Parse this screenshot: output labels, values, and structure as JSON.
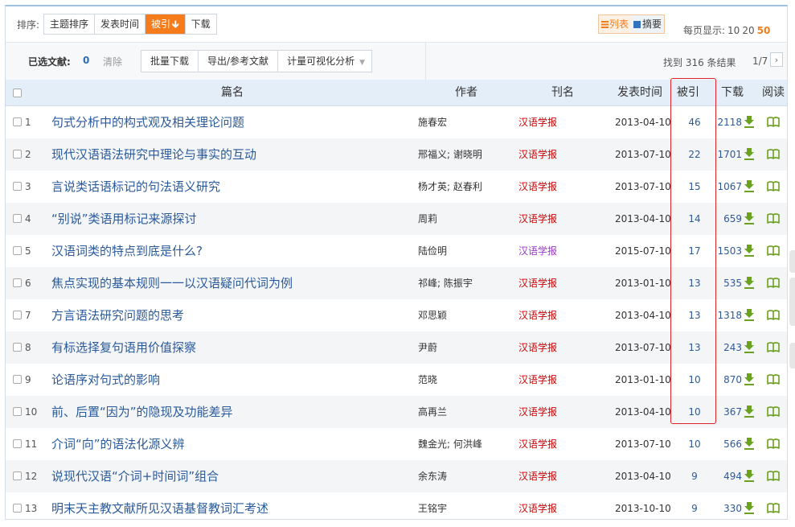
{
  "sort_bar": {
    "label": "排序:",
    "buttons": [
      {
        "label": "主题排序",
        "active": false
      },
      {
        "label": "发表时间",
        "active": false
      },
      {
        "label": "被引",
        "active": true
      },
      {
        "label": "下载",
        "active": false
      }
    ],
    "sort_direction_icon": "arrow-down-icon",
    "view_modes": [
      {
        "label": "列表",
        "icon": "list-icon",
        "active": true
      },
      {
        "label": "摘要",
        "icon": "abstract-icon",
        "active": false
      }
    ],
    "per_page_label": "每页显示:",
    "per_page_options": [
      "10",
      "20",
      "50"
    ],
    "per_page_selected": "50"
  },
  "toolbar": {
    "selected_label": "已选文献:",
    "selected_count": "0",
    "clear_label": "清除",
    "buttons": [
      "批量下载",
      "导出/参考文献",
      "计量可视化分析"
    ],
    "found_text": "找到 316 条结果",
    "page_indicator": "1/7",
    "next_label": "›"
  },
  "table": {
    "columns": [
      "篇名",
      "作者",
      "刊名",
      "发表时间",
      "被引",
      "下载",
      "阅读"
    ],
    "rows": [
      {
        "num": "1",
        "title": "句式分析中的构式观及相关理论问题",
        "author": "施春宏",
        "journal": "汉语学报",
        "date": "2013-04-10",
        "cited": "46",
        "downloads": "2118"
      },
      {
        "num": "2",
        "title": "现代汉语语法研究中理论与事实的互动",
        "author": "邢福义; 谢晓明",
        "journal": "汉语学报",
        "date": "2013-07-10",
        "cited": "22",
        "downloads": "1701"
      },
      {
        "num": "3",
        "title": "言说类话语标记的句法语义研究",
        "author": "杨才英; 赵春利",
        "journal": "汉语学报",
        "date": "2013-07-10",
        "cited": "15",
        "downloads": "1067"
      },
      {
        "num": "4",
        "title": "“别说”类语用标记来源探讨",
        "author": "周莉",
        "journal": "汉语学报",
        "date": "2013-04-10",
        "cited": "14",
        "downloads": "659"
      },
      {
        "num": "5",
        "title": "汉语词类的特点到底是什么?",
        "author": "陆俭明",
        "journal": "汉语学报",
        "date": "2015-07-10",
        "cited": "17",
        "downloads": "1503"
      },
      {
        "num": "6",
        "title": "焦点实现的基本规则一一以汉语疑问代词为例",
        "author": "祁峰; 陈振宇",
        "journal": "汉语学报",
        "date": "2013-01-10",
        "cited": "13",
        "downloads": "535"
      },
      {
        "num": "7",
        "title": "方言语法研究问题的思考",
        "author": "邓思颖",
        "journal": "汉语学报",
        "date": "2013-04-10",
        "cited": "13",
        "downloads": "1318"
      },
      {
        "num": "8",
        "title": "有标选择复句语用价值探察",
        "author": "尹蔚",
        "journal": "汉语学报",
        "date": "2013-07-10",
        "cited": "13",
        "downloads": "243"
      },
      {
        "num": "9",
        "title": "论语序对句式的影响",
        "author": "范晓",
        "journal": "汉语学报",
        "date": "2013-01-10",
        "cited": "10",
        "downloads": "870"
      },
      {
        "num": "10",
        "title": "前、后置“因为”的隐现及功能差异",
        "author": "高再兰",
        "journal": "汉语学报",
        "date": "2013-04-10",
        "cited": "10",
        "downloads": "367"
      },
      {
        "num": "11",
        "title": "介词“向”的语法化源义辨",
        "author": "魏金光; 何洪峰",
        "journal": "汉语学报",
        "date": "2013-07-10",
        "cited": "10",
        "downloads": "566"
      },
      {
        "num": "12",
        "title": "说现代汉语“介词+时间词”组合",
        "author": "余东涛",
        "journal": "汉语学报",
        "date": "2013-04-10",
        "cited": "9",
        "downloads": "494"
      },
      {
        "num": "13",
        "title": "明末天主教文献所见汉语基督教词汇考述",
        "author": "王铭宇",
        "journal": "汉语学报",
        "date": "2013-10-10",
        "cited": "9",
        "downloads": "330"
      }
    ]
  },
  "colors": {
    "accent_orange": "#f67b1a",
    "link_blue": "#2a5a9c",
    "journal_red": "#cc0000",
    "journal_purple": "#9b35c8",
    "highlight_red": "#e0232b",
    "icon_green": "#6aa121"
  }
}
